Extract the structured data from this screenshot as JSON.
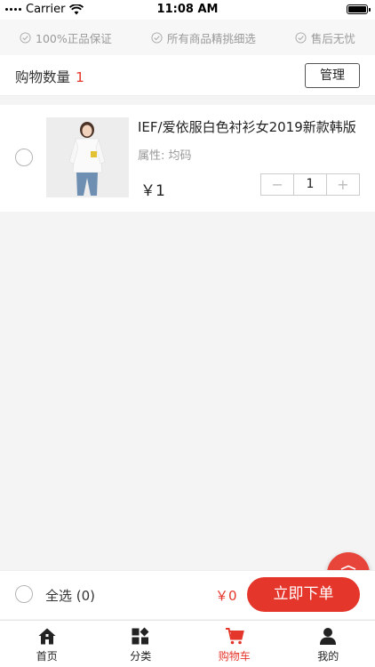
{
  "status_bar": {
    "carrier": "Carrier",
    "time": "11:08 AM"
  },
  "guarantees": [
    {
      "label": "100%正品保证",
      "icon": "check-circle-icon"
    },
    {
      "label": "所有商品精挑细选",
      "icon": "check-circle-icon"
    },
    {
      "label": "售后无忧",
      "icon": "check-circle-icon"
    }
  ],
  "header": {
    "count_label": "购物数量",
    "count": "1",
    "manage_label": "管理"
  },
  "item": {
    "title": "IEF/爱依服白色衬衫女2019新款韩版",
    "attribute": "属性:  均码",
    "price": "￥1",
    "quantity": "1",
    "minus_symbol": "−",
    "plus_symbol": "+"
  },
  "footer": {
    "select_all_label": "全选 (0)",
    "total": "￥0",
    "order_label": "立即下单"
  },
  "tabs": [
    {
      "label": "首页",
      "icon": "home-icon"
    },
    {
      "label": "分类",
      "icon": "category-icon"
    },
    {
      "label": "购物车",
      "icon": "cart-icon",
      "active": true
    },
    {
      "label": "我的",
      "icon": "user-icon"
    }
  ],
  "colors": {
    "accent": "#e5362c",
    "background": "#f4f4f4"
  }
}
